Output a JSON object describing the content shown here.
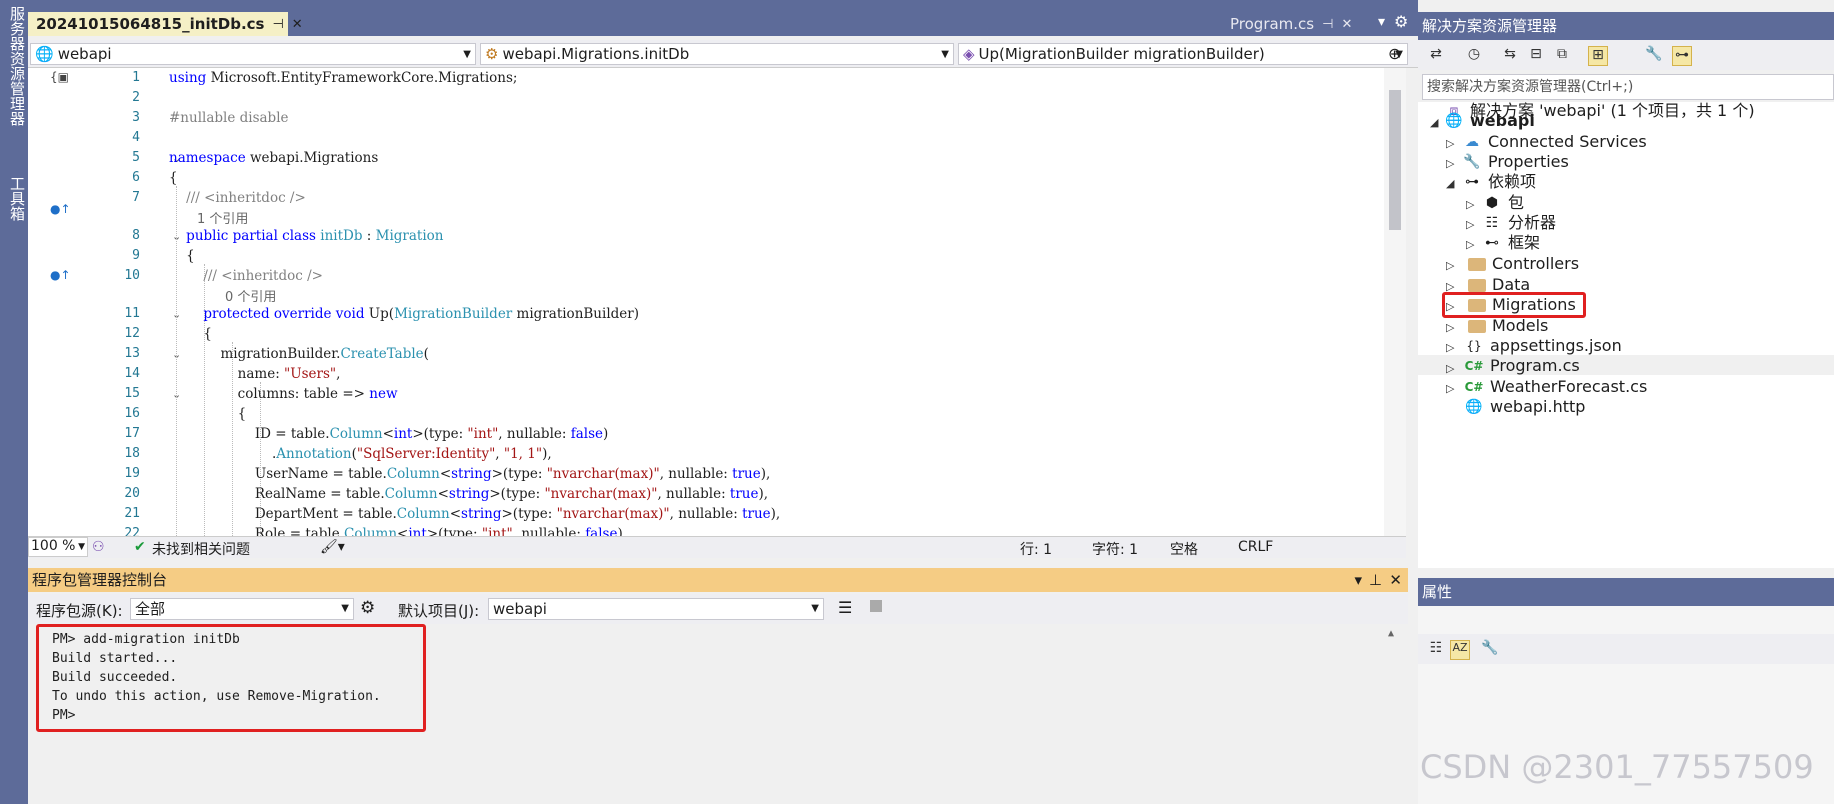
{
  "left_strip": {
    "tab1": "服务器资源管理器",
    "tab2": "工具箱"
  },
  "editor_tabs": {
    "active": {
      "title": "20241015064815_initDb.cs",
      "pin": "⊣",
      "close": "✕"
    },
    "other": {
      "title": "Program.cs",
      "pin": "⊣",
      "close": "✕"
    },
    "overflow": "▾",
    "settings": "⚙"
  },
  "navbar": {
    "project": "webapi",
    "class": "webapi.Migrations.initDb",
    "member": "Up(MigrationBuilder migrationBuilder)"
  },
  "code": {
    "line_numbers": [
      "1",
      "2",
      "3",
      "4",
      "5",
      "6",
      "7",
      "8",
      "9",
      "10",
      "11",
      "12",
      "13",
      "14",
      "15",
      "16",
      "17",
      "18",
      "19",
      "20",
      "21",
      "22"
    ],
    "ref_1": "1 个引用",
    "ref_0": "0 个引用"
  },
  "statusbar": {
    "zoom": "100 %",
    "issues": "未找到相关问题",
    "line": "行: 1",
    "char": "字符: 1",
    "spaces": "空格",
    "eol": "CRLF"
  },
  "pmc": {
    "title": "程序包管理器控制台",
    "source_label": "程序包源(K):",
    "source_value": "全部",
    "default_project_label": "默认项目(J):",
    "default_project_value": "webapi",
    "lines": [
      "PM> add-migration initDb",
      "Build started...",
      "Build succeeded.",
      "To undo this action, use Remove-Migration.",
      "PM>"
    ],
    "head_buttons": {
      "dropdown": "▾",
      "pin": "⊥",
      "close": "✕"
    }
  },
  "solution": {
    "title": "解决方案资源管理器",
    "search_placeholder": "搜索解决方案资源管理器(Ctrl+;)",
    "root": "解决方案 'webapi' (1 个项目，共 1 个)",
    "project": "webapi",
    "items": [
      {
        "label": "Connected Services"
      },
      {
        "label": "Properties"
      },
      {
        "label": "依赖项"
      },
      {
        "label": "包"
      },
      {
        "label": "分析器"
      },
      {
        "label": "框架"
      },
      {
        "label": "Controllers"
      },
      {
        "label": "Data"
      },
      {
        "label": "Migrations"
      },
      {
        "label": "Models"
      },
      {
        "label": "appsettings.json"
      },
      {
        "label": "Program.cs"
      },
      {
        "label": "WeatherForecast.cs"
      },
      {
        "label": "webapi.http"
      }
    ]
  },
  "properties": {
    "title": "属性"
  },
  "watermark": "CSDN @2301_77557509",
  "colors": {
    "vs_blue": "#5d6b99",
    "tab_yellow": "#f5f0c6",
    "pmc_header": "#f5cc84",
    "highlight_red": "#e02020"
  }
}
